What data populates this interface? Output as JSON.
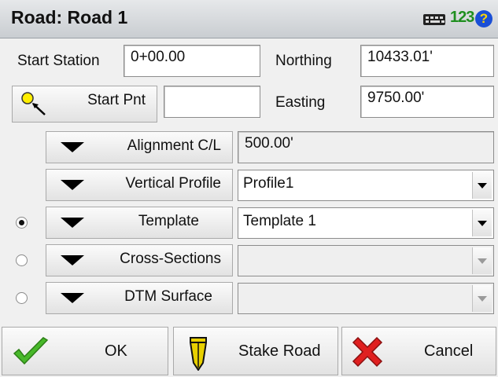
{
  "window": {
    "title": "Road: Road 1",
    "keyboard_icon": "keyboard-icon",
    "numeric_label": "123",
    "help_label": "?"
  },
  "start_station": {
    "label": "Start Station",
    "value": "0+00.00"
  },
  "northing": {
    "label": "Northing",
    "value": "10433.01'"
  },
  "start_pnt": {
    "label": "Start Pnt",
    "value": "",
    "icon": "point-select-icon"
  },
  "easting": {
    "label": "Easting",
    "value": "9750.00'"
  },
  "rows": [
    {
      "label": "Alignment C/L",
      "value": "500.00'",
      "dropdown": false,
      "enabled": true
    },
    {
      "label": "Vertical Profile",
      "value": "Profile1",
      "dropdown": true,
      "enabled": true
    },
    {
      "label": "Template",
      "value": "Template 1",
      "dropdown": true,
      "enabled": true,
      "radio": "selected"
    },
    {
      "label": "Cross-Sections",
      "value": "",
      "dropdown": true,
      "enabled": false,
      "radio": "unselected"
    },
    {
      "label": "DTM Surface",
      "value": "",
      "dropdown": true,
      "enabled": false,
      "radio": "unselected"
    }
  ],
  "footer": {
    "ok": {
      "label": "OK",
      "icon": "checkmark-icon",
      "color": "#48b82a"
    },
    "stake": {
      "label": "Stake Road",
      "icon": "stake-icon",
      "color": "#e8d000"
    },
    "cancel": {
      "label": "Cancel",
      "icon": "x-icon",
      "color": "#e02020"
    }
  }
}
